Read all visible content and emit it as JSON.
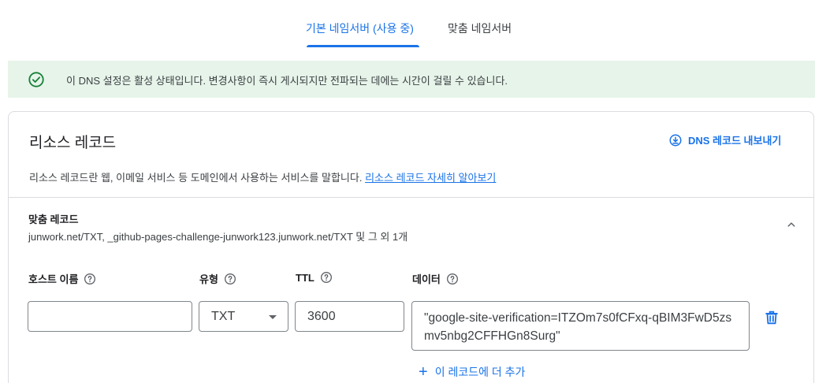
{
  "tabs": [
    {
      "label": "기본 네임서버 (사용 중)",
      "active": true
    },
    {
      "label": "맞춤 네임서버",
      "active": false
    }
  ],
  "banner": {
    "icon": "check-circle-icon",
    "text": "이 DNS 설정은 활성 상태입니다. 변경사항이 즉시 게시되지만 전파되는 데에는 시간이 걸릴 수 있습니다.",
    "bg_color": "#e6f4ea",
    "icon_color": "#188038"
  },
  "card": {
    "title": "리소스 레코드",
    "export_label": "DNS 레코드 내보내기",
    "export_icon": "download-circle-icon",
    "description": "리소스 레코드란 웹, 이메일 서비스 등 도메인에서 사용하는 서비스를 말합니다.",
    "learn_more": "리소스 레코드 자세히 알아보기"
  },
  "custom_records": {
    "title": "맞춤 레코드",
    "summary": "junwork.net/TXT, _github-pages-challenge-junwork123.junwork.net/TXT 및 그 외 1개",
    "collapse_icon": "chevron-up-icon",
    "columns": {
      "host": "호스트 이름",
      "type": "유형",
      "ttl": "TTL",
      "data": "데이터"
    },
    "row": {
      "host": "",
      "type": "TXT",
      "ttl": "3600",
      "data": "\"google-site-verification=ITZOm7s0fCFxq-qBIM3FwD5zsmv5nbg2CFFHGn8Surg\""
    },
    "add_more_label": "이 레코드에 더 추가"
  },
  "colors": {
    "accent": "#1a73e8",
    "text": "#202124",
    "border": "#dadce0"
  }
}
